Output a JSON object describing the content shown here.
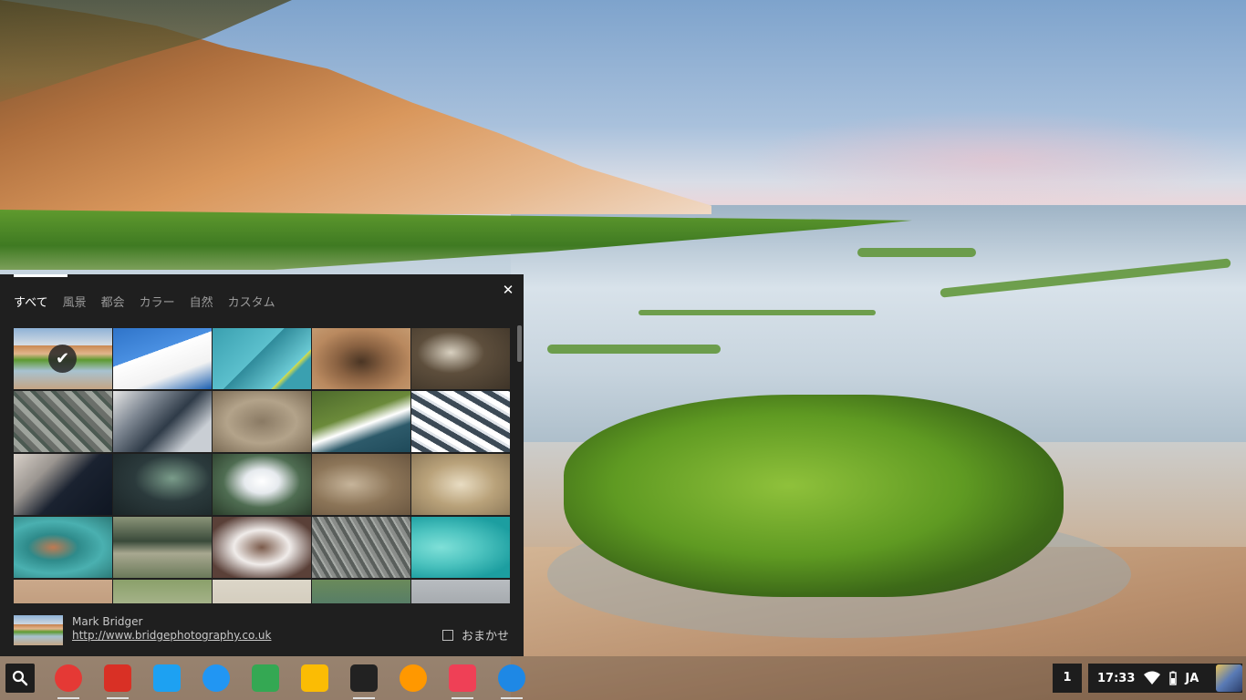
{
  "wallpaper_picker": {
    "tabs": [
      {
        "label": "すべて",
        "active": true
      },
      {
        "label": "風景",
        "active": false
      },
      {
        "label": "都会",
        "active": false
      },
      {
        "label": "カラー",
        "active": false
      },
      {
        "label": "自然",
        "active": false
      },
      {
        "label": "カスタム",
        "active": false
      }
    ],
    "close_symbol": "✕",
    "selected_check": "✔",
    "thumbnail_count": 25,
    "author_name": "Mark Bridger",
    "author_url": "http://www.bridgephotography.co.uk",
    "surprise_me_label": "おまかせ",
    "surprise_me_checked": false
  },
  "shelf": {
    "launcher_icon": "search-icon",
    "apps": [
      {
        "name": "chrome-icon",
        "color": "#e53935",
        "running": true
      },
      {
        "name": "gmail-icon",
        "color": "#d93025",
        "running": true
      },
      {
        "name": "twitter-icon",
        "color": "#1da1f2",
        "running": false
      },
      {
        "name": "files-icon",
        "color": "#2196f3",
        "running": false
      },
      {
        "name": "maps-icon",
        "color": "#34a853",
        "running": false
      },
      {
        "name": "photos-icon",
        "color": "#fbbc04",
        "running": false
      },
      {
        "name": "kindle-icon",
        "color": "#222222",
        "running": true
      },
      {
        "name": "music-icon",
        "color": "#ff9800",
        "running": false
      },
      {
        "name": "pocket-icon",
        "color": "#ef4056",
        "running": true
      },
      {
        "name": "wallpaper-picker-icon",
        "color": "#1e88e5",
        "running": true
      }
    ],
    "notification_count": "1",
    "time": "17:33",
    "ime": "JA"
  }
}
